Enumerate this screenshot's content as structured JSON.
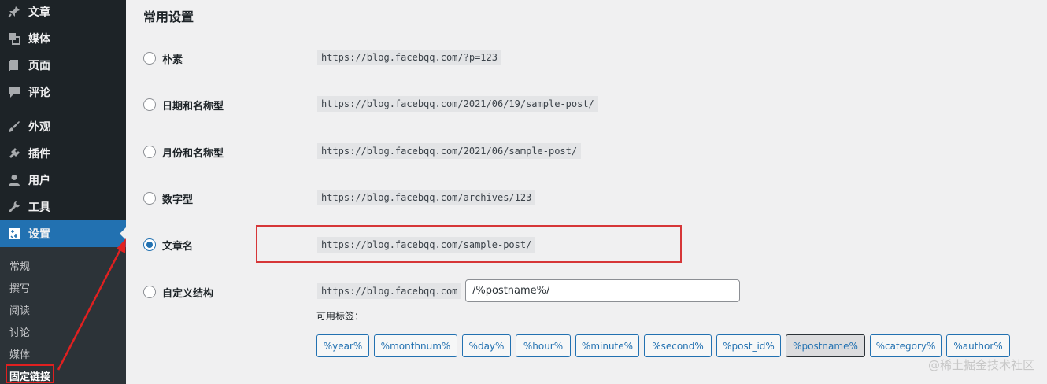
{
  "sidebar": {
    "items": [
      {
        "label": "文章",
        "icon": "pin-icon"
      },
      {
        "label": "媒体",
        "icon": "media-icon"
      },
      {
        "label": "页面",
        "icon": "page-icon"
      },
      {
        "label": "评论",
        "icon": "comment-icon"
      },
      {
        "label": "外观",
        "icon": "brush-icon"
      },
      {
        "label": "插件",
        "icon": "plugin-icon"
      },
      {
        "label": "用户",
        "icon": "user-icon"
      },
      {
        "label": "工具",
        "icon": "wrench-icon"
      },
      {
        "label": "设置",
        "icon": "settings-icon",
        "active": true
      }
    ],
    "submenu": [
      {
        "label": "常规"
      },
      {
        "label": "撰写"
      },
      {
        "label": "阅读"
      },
      {
        "label": "讨论"
      },
      {
        "label": "媒体"
      },
      {
        "label": "固定链接",
        "current": true
      }
    ]
  },
  "main": {
    "section_title": "常用设置",
    "options": [
      {
        "label": "朴素",
        "url": "https://blog.facebqq.com/?p=123",
        "checked": false
      },
      {
        "label": "日期和名称型",
        "url": "https://blog.facebqq.com/2021/06/19/sample-post/",
        "checked": false
      },
      {
        "label": "月份和名称型",
        "url": "https://blog.facebqq.com/2021/06/sample-post/",
        "checked": false
      },
      {
        "label": "数字型",
        "url": "https://blog.facebqq.com/archives/123",
        "checked": false
      },
      {
        "label": "文章名",
        "url": "https://blog.facebqq.com/sample-post/",
        "checked": true
      },
      {
        "label": "自定义结构",
        "url": "https://blog.facebqq.com",
        "checked": false
      }
    ],
    "custom_structure_value": "/%postname%/",
    "tags_label": "可用标签：",
    "tags": [
      {
        "label": "%year%"
      },
      {
        "label": "%monthnum%"
      },
      {
        "label": "%day%"
      },
      {
        "label": "%hour%"
      },
      {
        "label": "%minute%"
      },
      {
        "label": "%second%"
      },
      {
        "label": "%post_id%"
      },
      {
        "label": "%postname%",
        "pressed": true
      },
      {
        "label": "%category%"
      },
      {
        "label": "%author%"
      }
    ]
  },
  "watermark": "@稀土掘金技术社区",
  "colors": {
    "sidebar_bg": "#1d2327",
    "submenu_bg": "#2c3338",
    "accent": "#2271b1",
    "highlight_red": "#d63638"
  }
}
